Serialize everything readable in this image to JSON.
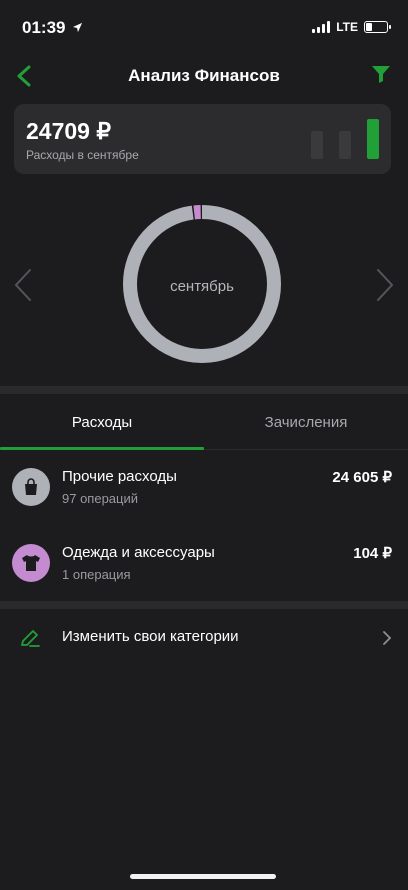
{
  "status": {
    "time": "01:39",
    "network": "LTE"
  },
  "header": {
    "title": "Анализ Финансов"
  },
  "summary": {
    "amount": "24709 ₽",
    "label": "Расходы в сентябре",
    "bar_levels": [
      0.7,
      0.7,
      1.0
    ]
  },
  "donut": {
    "center_label": "сентябрь",
    "segments": [
      {
        "name": "Прочие расходы",
        "value": 24605,
        "color": "#aeb2b8"
      },
      {
        "name": "Одежда и аксессуары",
        "value": 104,
        "color": "#c58bd0"
      }
    ]
  },
  "tabs": [
    {
      "label": "Расходы",
      "active": true
    },
    {
      "label": "Зачисления",
      "active": false
    }
  ],
  "categories": [
    {
      "name": "Прочие расходы",
      "count": "97 операций",
      "amount": "24 605 ₽",
      "icon": "shopping-bag-icon",
      "color": "#aeb2b8"
    },
    {
      "name": "Одежда и аксессуары",
      "count": "1 операция",
      "amount": "104 ₽",
      "icon": "tshirt-icon",
      "color": "#c58bd0"
    }
  ],
  "edit_categories": {
    "label": "Изменить свои категории",
    "icon": "pencil-icon"
  },
  "colors": {
    "accent": "#21a038",
    "background": "#1c1c1e",
    "card": "#2c2c2e"
  }
}
